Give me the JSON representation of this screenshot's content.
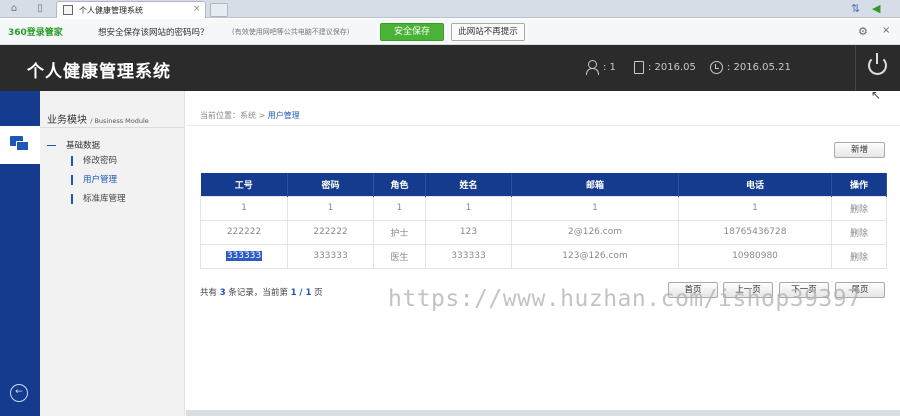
{
  "browser": {
    "tab_title": "个人健康管理系统",
    "tab_close": "×",
    "icons": [
      "home-icon",
      "page-icon",
      "sync-icon",
      "back-arrow-icon"
    ]
  },
  "password_bar": {
    "brand": "360登录管家",
    "question": "想安全保存该网站的密码吗？",
    "hint": "(有效使用网吧等公共电脑不建议保存)",
    "save_label": "安全保存",
    "never_label": "此网站不再提示",
    "gear": "⚙",
    "close": "×"
  },
  "header": {
    "title": "个人健康管理系统",
    "user_count": ": 1",
    "doc_date": ": 2016.05",
    "clock_date": ": 2016.05.21"
  },
  "sidebar": {
    "title": "业务模块",
    "title_en": "/ Business Module",
    "group": "基础数据",
    "items": [
      {
        "label": "修改密码"
      },
      {
        "label": "用户管理"
      },
      {
        "label": "标准库管理"
      }
    ]
  },
  "breadcrumb": {
    "prefix": "当前位置：系统 >",
    "current": "用户管理"
  },
  "toolbar": {
    "add_label": "新增"
  },
  "table": {
    "headers": [
      "工号",
      "密码",
      "角色",
      "姓名",
      "邮箱",
      "电话",
      "操作"
    ],
    "rows": [
      {
        "id": "1",
        "password": "1",
        "role": "1",
        "name": "1",
        "email": "1",
        "phone": "1",
        "action": "删除"
      },
      {
        "id": "222222",
        "password": "222222",
        "role": "护士",
        "name": "123",
        "email": "2@126.com",
        "phone": "18765436728",
        "action": "删除"
      },
      {
        "id": "333333",
        "password": "333333",
        "role": "医生",
        "name": "333333",
        "email": "123@126.com",
        "phone": "10980980",
        "action": "删除"
      }
    ]
  },
  "pager": {
    "t1": "共有",
    "total": "3",
    "t2": "条记录，当前第",
    "page": "1 / 1",
    "t3": "页",
    "first": "首页",
    "prev": "上一页",
    "next": "下一页",
    "last": "尾页"
  },
  "watermark": "https://www.huzhan.com/ishop39397",
  "colors": {
    "header_bg": "#2b2b2b",
    "rail_bg": "#143b8d",
    "table_header": "#143b8d",
    "accent": "#1f57b9",
    "save_green": "#4ab337"
  }
}
